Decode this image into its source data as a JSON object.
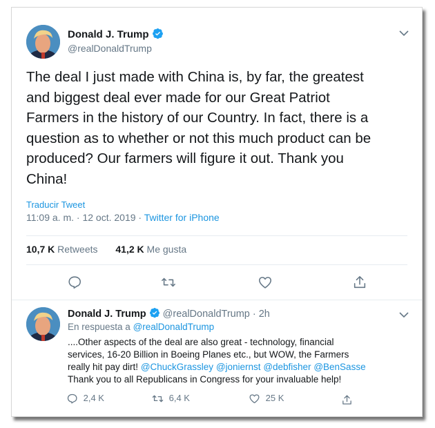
{
  "main_tweet": {
    "author_name": "Donald J. Trump",
    "author_handle": "@realDonaldTrump",
    "lines": [
      "The deal I just made with China is, by far, the greatest",
      "and biggest deal ever made for our Great Patriot",
      "Farmers in the history of our Country. In fact, there is a",
      "question as to whether or not this much product can be",
      "produced? Our farmers will figure it out. Thank you",
      "China!"
    ],
    "translate_label": "Traducir Tweet",
    "time": "11:09 a. m.",
    "date_sep": "·",
    "date": "12 oct. 2019",
    "source_sep": "·",
    "source": "Twitter for iPhone",
    "retweets_count": "10,7 K",
    "retweets_label": "Retweets",
    "likes_count": "41,2 K",
    "likes_label": "Me gusta"
  },
  "reply_tweet": {
    "author_name": "Donald J. Trump",
    "author_handle": "@realDonaldTrump",
    "time_ago": "· 2h",
    "replying_prefix": "En respuesta a",
    "replying_handle": "@realDonaldTrump",
    "lines": [
      "....Other aspects of the deal are also great - technology, financial",
      "services, 16-20 Billion in Boeing Planes etc., but WOW, the Farmers",
      "really hit pay dirt!"
    ],
    "mentions": [
      "@ChuckGrassley",
      "@joniernst",
      "@debfisher",
      "@BenSasse"
    ],
    "last_line": "Thank you to all Republicans in Congress for your invaluable help!",
    "reply_count": "2,4 K",
    "retweet_count": "6,4 K",
    "like_count": "25 K"
  },
  "icons": {
    "verified": "verified-badge-icon",
    "chevron": "chevron-down-icon",
    "reply": "reply-icon",
    "retweet": "retweet-icon",
    "like": "heart-icon",
    "share": "share-icon"
  },
  "colors": {
    "link": "#1b95e0",
    "muted": "#657786",
    "text": "#14171a",
    "verified": "#1da1f2"
  }
}
